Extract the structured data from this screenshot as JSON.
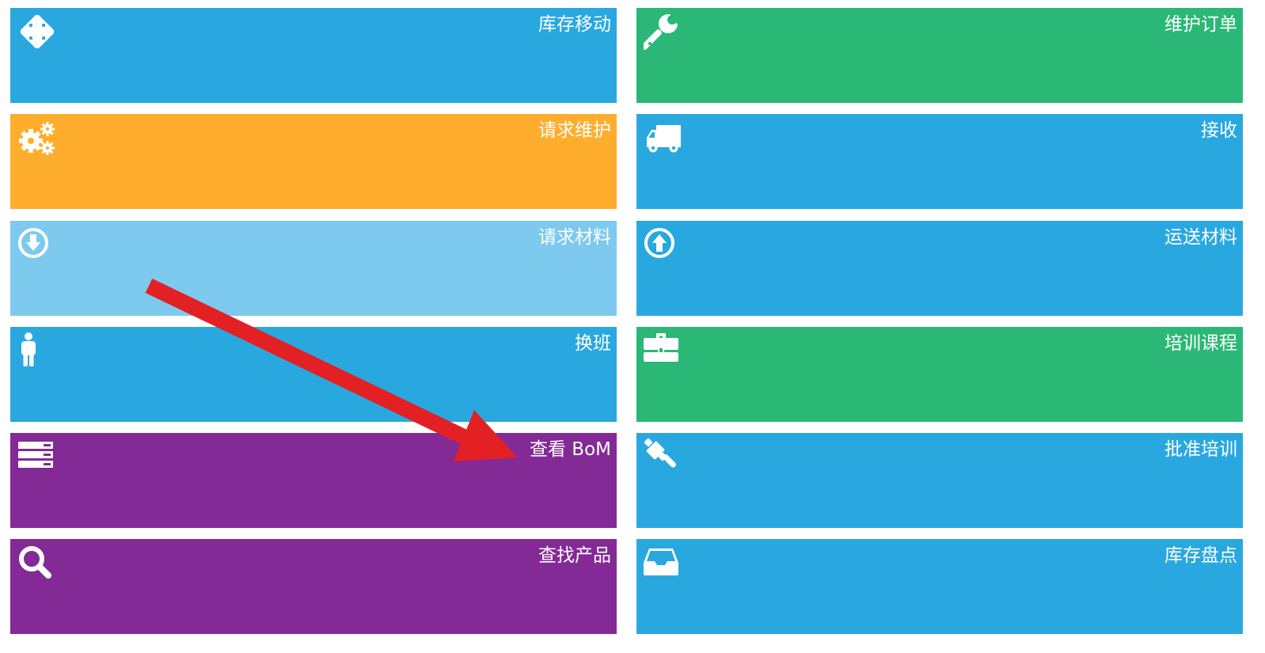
{
  "colors": {
    "blue": "#29a8e0",
    "green": "#2bb877",
    "orange": "#ffad2d",
    "light_blue": "#7dcaee",
    "purple": "#832a96",
    "annotation_red": "#e32024"
  },
  "tiles": {
    "inventory_move": {
      "label": "库存移动",
      "icon": "move-arrows-icon",
      "color": "blue"
    },
    "request_maintenance": {
      "label": "请求维护",
      "icon": "gears-icon",
      "color": "orange"
    },
    "request_material": {
      "label": "请求材料",
      "icon": "download-circle-icon",
      "color": "light_blue"
    },
    "shift_change": {
      "label": "换班",
      "icon": "person-icon",
      "color": "blue"
    },
    "view_bom": {
      "label": "查看 BoM",
      "icon": "server-stack-icon",
      "color": "purple"
    },
    "find_product": {
      "label": "查找产品",
      "icon": "magnifier-icon",
      "color": "purple"
    },
    "maintenance_order": {
      "label": "维护订单",
      "icon": "wrench-icon",
      "color": "green"
    },
    "receive": {
      "label": "接收",
      "icon": "truck-icon",
      "color": "blue"
    },
    "ship_material": {
      "label": "运送材料",
      "icon": "upload-circle-icon",
      "color": "blue"
    },
    "training_courses": {
      "label": "培训课程",
      "icon": "briefcase-icon",
      "color": "green"
    },
    "approve_training": {
      "label": "批准培训",
      "icon": "gavel-icon",
      "color": "blue"
    },
    "inventory_count": {
      "label": "库存盘点",
      "icon": "inbox-tray-icon",
      "color": "blue"
    }
  },
  "annotation": {
    "type": "arrow",
    "color": "annotation_red",
    "points_to": "view_bom"
  }
}
